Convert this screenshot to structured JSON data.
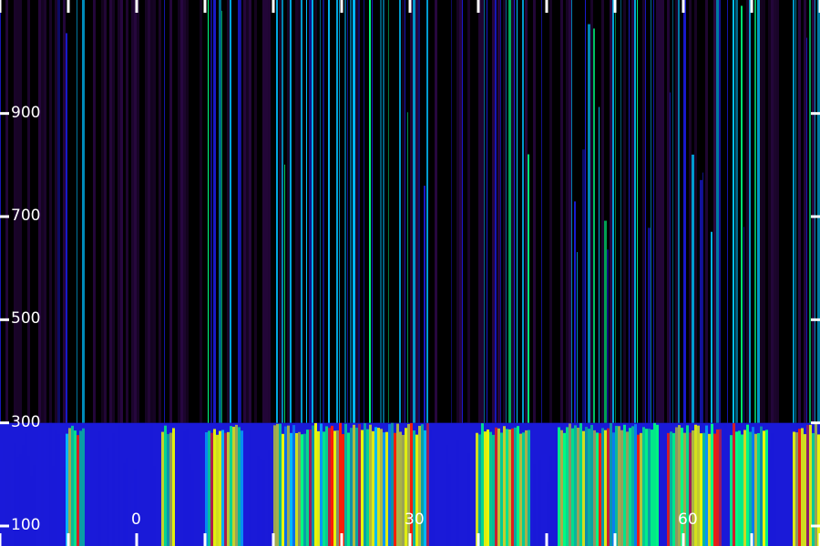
{
  "chart_data": {
    "type": "heatmap",
    "title": "",
    "xlabel": "",
    "ylabel": "",
    "y_ticks": [
      {
        "value": 100,
        "label": "100"
      },
      {
        "value": 300,
        "label": "300"
      },
      {
        "value": 500,
        "label": "500"
      },
      {
        "value": 700,
        "label": "700"
      },
      {
        "value": 900,
        "label": "900"
      }
    ],
    "x_ticks": [
      {
        "value": 0,
        "label": "0"
      },
      {
        "value": 30,
        "label": "30"
      },
      {
        "value": 60,
        "label": "60"
      }
    ],
    "ylim": [
      100,
      1120
    ],
    "xlim": [
      -15,
      75
    ],
    "band_edge_y": 300,
    "colormap": [
      "#3a0a5e",
      "#1a1ad8",
      "#00bfff",
      "#00ff80",
      "#f0ff00",
      "#ff2000"
    ],
    "background_color": "#000000",
    "tick_color": "#ffffff"
  }
}
